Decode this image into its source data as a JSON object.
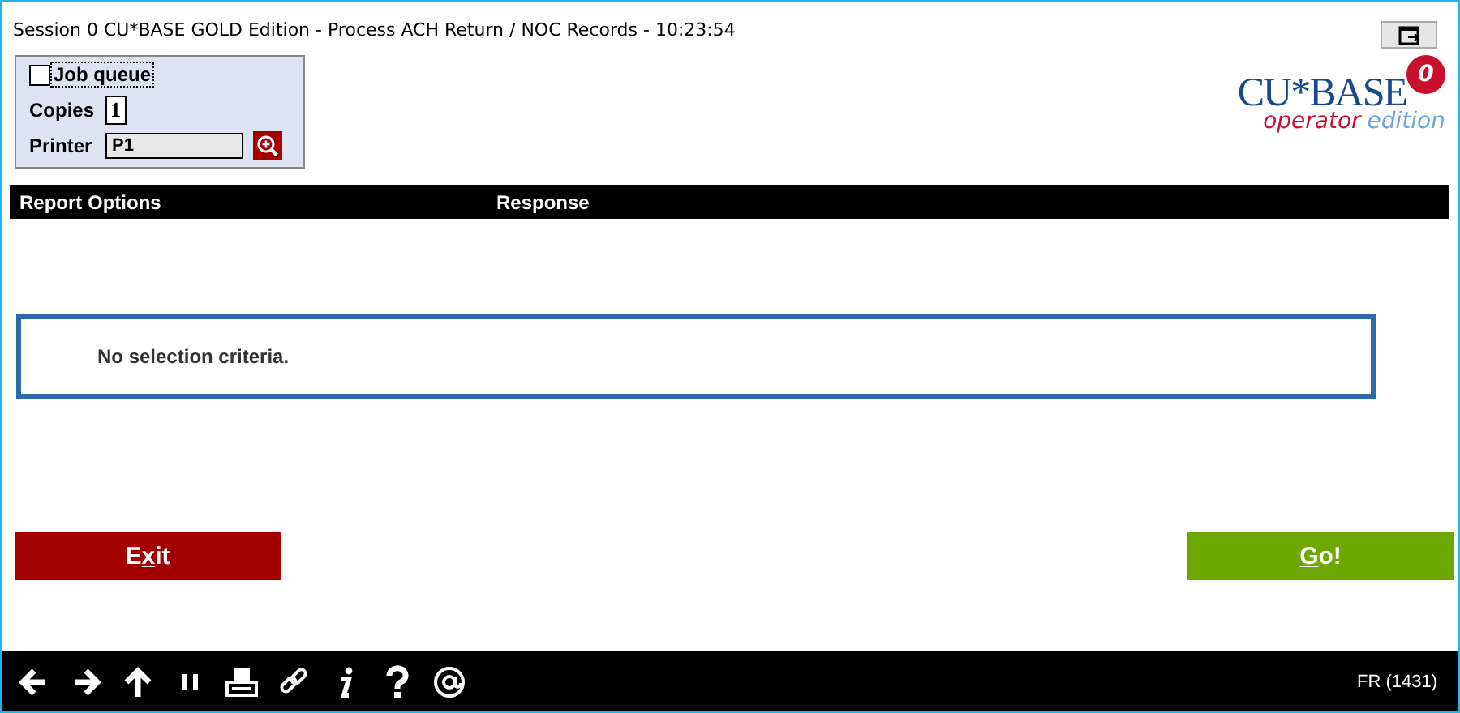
{
  "window": {
    "title": "Session 0 CU*BASE GOLD Edition - Process ACH Return / NOC Records - 10:23:54"
  },
  "options": {
    "job_queue": {
      "label": "Job queue",
      "checked": false
    },
    "copies": {
      "label": "Copies",
      "value": "1"
    },
    "printer": {
      "label": "Printer",
      "value": "P1"
    }
  },
  "logo": {
    "badge": "0",
    "name": "CU*BASE",
    "tagline_start": "operator",
    "tagline_end": "edition"
  },
  "table": {
    "columns": [
      "Report Options",
      "Response"
    ]
  },
  "message": "No selection criteria.",
  "buttons": [
    {
      "kind": "exit",
      "label_start": "E",
      "hotkey": "x",
      "label_end": "it"
    },
    {
      "kind": "go",
      "hotkey": "G",
      "label_end": "o!"
    }
  ],
  "toolbar": {
    "icons": [
      {
        "kind": "back"
      },
      {
        "kind": "forward"
      },
      {
        "kind": "up"
      },
      {
        "kind": "pause"
      },
      {
        "kind": "print"
      },
      {
        "kind": "link"
      },
      {
        "kind": "info"
      },
      {
        "kind": "help"
      },
      {
        "kind": "email"
      }
    ],
    "status": "FR (1431)"
  }
}
